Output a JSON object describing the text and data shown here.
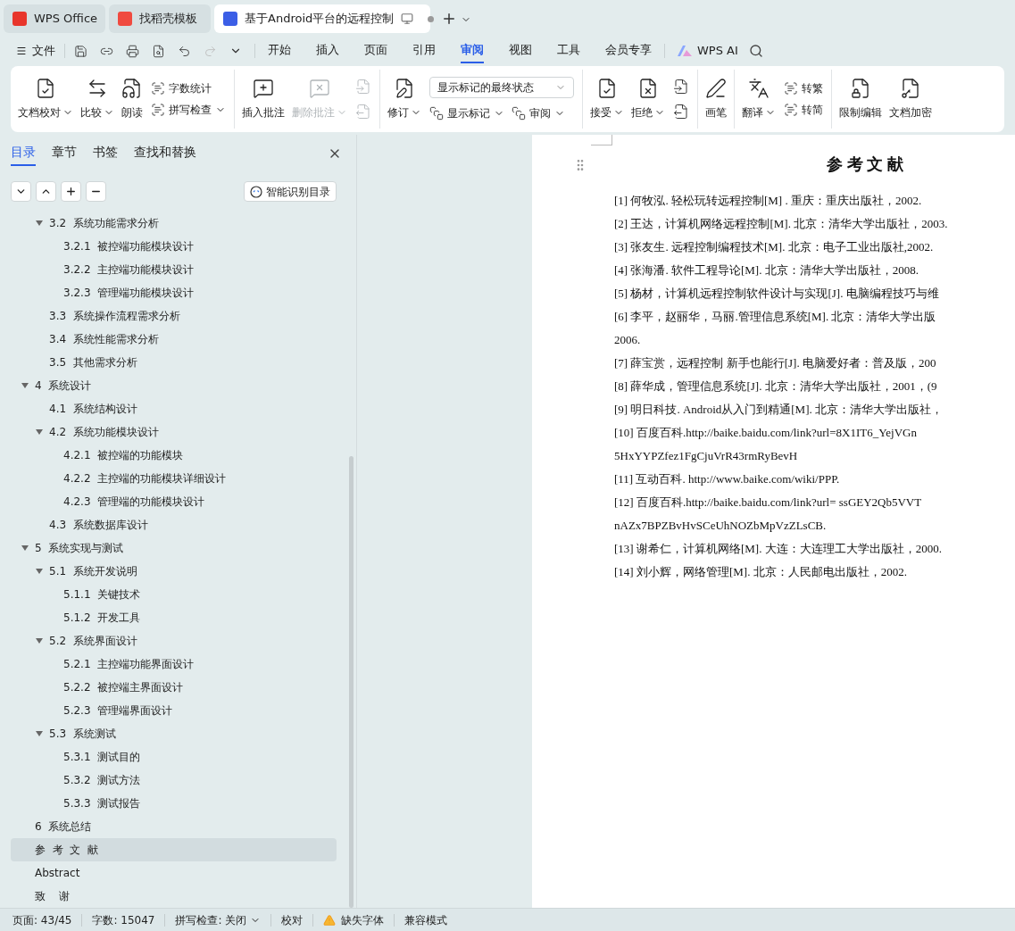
{
  "browser_tabs": [
    {
      "label": "WPS Office",
      "selected": false
    },
    {
      "label": "找稻壳模板",
      "selected": false
    },
    {
      "label": "基于Android平台的远程控制",
      "selected": true
    }
  ],
  "quick_bar": {
    "file_menu": "文件"
  },
  "menu_tabs": [
    {
      "label": "开始",
      "selected": false
    },
    {
      "label": "插入",
      "selected": false
    },
    {
      "label": "页面",
      "selected": false
    },
    {
      "label": "引用",
      "selected": false
    },
    {
      "label": "审阅",
      "selected": true
    },
    {
      "label": "视图",
      "selected": false
    },
    {
      "label": "工具",
      "selected": false
    },
    {
      "label": "会员专享",
      "selected": false
    }
  ],
  "ai_button": "WPS AI",
  "ribbon": [
    {
      "items": [
        {
          "kind": "large",
          "label": "文档校对",
          "dropdown": true,
          "disabled": false
        },
        {
          "kind": "large",
          "label": "比较",
          "dropdown": true,
          "disabled": false
        },
        {
          "kind": "large",
          "label": "朗读",
          "dropdown": false,
          "disabled": false
        },
        {
          "kind": "stack",
          "top": {
            "label": "字数统计",
            "dropdown": false
          },
          "bottom": {
            "label": "拼写检查",
            "dropdown": true
          }
        }
      ]
    },
    {
      "items": [
        {
          "kind": "large",
          "label": "插入批注",
          "dropdown": false,
          "disabled": false
        },
        {
          "kind": "large",
          "label": "删除批注",
          "dropdown": true,
          "disabled": true
        },
        {
          "kind": "icons",
          "disabled": true
        }
      ]
    },
    {
      "items": [
        {
          "kind": "large",
          "label": "修订",
          "dropdown": true,
          "disabled": false
        },
        {
          "kind": "select",
          "value": "显示标记的最终状态",
          "options": [
            {
              "label": "显示标记",
              "dropdown": true
            },
            {
              "label": "审阅",
              "dropdown": true
            }
          ]
        }
      ]
    },
    {
      "items": [
        {
          "kind": "large",
          "label": "接受",
          "dropdown": true,
          "disabled": false
        },
        {
          "kind": "large",
          "label": "拒绝",
          "dropdown": true,
          "disabled": false
        },
        {
          "kind": "icons",
          "disabled": false
        }
      ]
    },
    {
      "items": [
        {
          "kind": "large",
          "label": "画笔",
          "dropdown": false,
          "disabled": false
        }
      ]
    },
    {
      "items": [
        {
          "kind": "large",
          "label": "翻译",
          "dropdown": true,
          "disabled": false
        },
        {
          "kind": "stack",
          "top": {
            "label": "转繁",
            "dropdown": false
          },
          "bottom": {
            "label": "转简",
            "dropdown": false
          }
        }
      ]
    },
    {
      "items": [
        {
          "kind": "large",
          "label": "限制编辑",
          "dropdown": false,
          "disabled": false
        },
        {
          "kind": "large",
          "label": "文档加密",
          "dropdown": false,
          "disabled": false
        }
      ]
    }
  ],
  "sidebar": {
    "tabs": [
      {
        "label": "目录",
        "selected": true
      },
      {
        "label": "章节",
        "selected": false
      },
      {
        "label": "书签",
        "selected": false
      },
      {
        "label": "查找和替换",
        "selected": false
      }
    ],
    "smart_button": "智能识别目录",
    "toc": [
      {
        "children": [
          {
            "label": "3.2  系统功能需求分析",
            "selected": false,
            "expanded": true,
            "children": [
              {
                "label": "3.2.1  被控端功能模块设计",
                "selected": false
              },
              {
                "label": "3.2.2  主控端功能模块设计",
                "selected": false
              },
              {
                "label": "3.2.3  管理端功能模块设计",
                "selected": false
              }
            ]
          },
          {
            "label": "3.3  系统操作流程需求分析",
            "selected": false
          },
          {
            "label": "3.4  系统性能需求分析",
            "selected": false
          },
          {
            "label": "3.5  其他需求分析",
            "selected": false
          }
        ]
      },
      {
        "label": "4  系统设计",
        "selected": false,
        "expanded": true,
        "children": [
          {
            "label": "4.1  系统结构设计",
            "selected": false
          },
          {
            "label": "4.2  系统功能模块设计",
            "selected": false,
            "expanded": true,
            "children": [
              {
                "label": "4.2.1  被控端的功能模块",
                "selected": false
              },
              {
                "label": "4.2.2  主控端的功能模块详细设计",
                "selected": false
              },
              {
                "label": "4.2.3  管理端的功能模块设计",
                "selected": false
              }
            ]
          },
          {
            "label": "4.3  系统数据库设计",
            "selected": false
          }
        ]
      },
      {
        "label": "5  系统实现与测试",
        "selected": false,
        "expanded": true,
        "children": [
          {
            "label": "5.1  系统开发说明",
            "selected": false,
            "expanded": true,
            "children": [
              {
                "label": "5.1.1  关键技术",
                "selected": false
              },
              {
                "label": "5.1.2  开发工具",
                "selected": false
              }
            ]
          },
          {
            "label": "5.2  系统界面设计",
            "selected": false,
            "expanded": true,
            "children": [
              {
                "label": "5.2.1  主控端功能界面设计",
                "selected": false
              },
              {
                "label": "5.2.2  被控端主界面设计",
                "selected": false
              },
              {
                "label": "5.2.3  管理端界面设计",
                "selected": false
              }
            ]
          },
          {
            "label": "5.3  系统测试",
            "selected": false,
            "expanded": true,
            "children": [
              {
                "label": "5.3.1  测试目的",
                "selected": false
              },
              {
                "label": "5.3.2  测试方法",
                "selected": false
              },
              {
                "label": "5.3.3  测试报告",
                "selected": false
              }
            ]
          }
        ]
      },
      {
        "label": "6  系统总结",
        "selected": false
      },
      {
        "label": "参  考  文  献",
        "selected": true
      },
      {
        "label": "Abstract",
        "selected": false
      },
      {
        "label": "致    谢",
        "selected": false
      }
    ]
  },
  "document": {
    "heading": "参 考 文 献",
    "lines": [
      "[1] 何牧泓. 轻松玩转远程控制[M] . 重庆：重庆出版社，2002.",
      "[2] 王达，计算机网络远程控制[M]. 北京：清华大学出版社，2003.",
      "[3] 张友生. 远程控制编程技术[M]. 北京：电子工业出版社,2002.",
      "[4] 张海潘. 软件工程导论[M]. 北京：清华大学出版社，2008.",
      "[5] 杨材，计算机远程控制软件设计与实现[J]. 电脑编程技巧与维",
      "[6] 李平，赵丽华，马丽.管理信息系统[M]. 北京：清华大学出版",
      "2006.",
      "[7] 薛宝赏，远程控制 新手也能行[J]. 电脑爱好者：普及版，200",
      "[8] 薛华成，管理信息系统[J]. 北京：清华大学出版社，2001，(9",
      "[9] 明日科技. Android从入门到精通[M]. 北京：清华大学出版社，",
      "[10] 百度百科.http://baike.baidu.com/link?url=8X1IT6_YejVGn",
      "5HxYYPZfez1FgCjuVrR43rmRyBevH",
      "[11] 互动百科. http://www.baike.com/wiki/PPP.",
      "[12] 百度百科.http://baike.baidu.com/link?url= ssGEY2Qb5VVT",
      "nAZx7BPZBvHvSCeUhNOZbMpVzZLsCB.",
      "[13] 谢希仁，计算机网络[M]. 大连：大连理工大学出版社，2000.",
      "[14] 刘小辉，网络管理[M]. 北京：人民邮电出版社，2002."
    ]
  },
  "status_bar": [
    {
      "kind": "text",
      "label": "页面: 43/45"
    },
    {
      "kind": "text",
      "label": "字数: 15047"
    },
    {
      "kind": "dropdown",
      "label": "拼写检查: 关闭"
    },
    {
      "kind": "text",
      "label": "校对"
    },
    {
      "kind": "warning",
      "label": "缺失字体"
    },
    {
      "kind": "text",
      "label": "兼容模式"
    }
  ]
}
